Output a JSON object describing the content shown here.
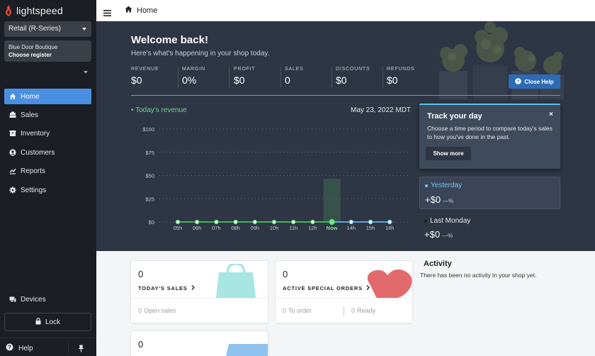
{
  "app": {
    "brand": "lightspeed"
  },
  "sidebar": {
    "store_select": "Retail (R-Series)",
    "register": {
      "shop": "Blue Door Boutique",
      "action": "Choose register"
    },
    "items": [
      {
        "label": "Home",
        "icon": "home-icon"
      },
      {
        "label": "Sales",
        "icon": "sales-icon"
      },
      {
        "label": "Inventory",
        "icon": "inventory-icon"
      },
      {
        "label": "Customers",
        "icon": "customers-icon"
      },
      {
        "label": "Reports",
        "icon": "reports-icon"
      },
      {
        "label": "Settings",
        "icon": "settings-icon"
      }
    ],
    "devices": "Devices",
    "lock": "Lock",
    "help": "Help"
  },
  "topbar": {
    "breadcrumb": "Home"
  },
  "hero": {
    "title": "Welcome back!",
    "subtitle": "Here's what's happening in your shop today.",
    "close_help": "Close Help",
    "kpis": [
      {
        "label": "REVENUE",
        "value": "$0"
      },
      {
        "label": "MARGIN",
        "value": "0%"
      },
      {
        "label": "PROFIT",
        "value": "$0"
      },
      {
        "label": "SALES",
        "value": "0"
      },
      {
        "label": "DISCOUNTS",
        "value": "$0"
      },
      {
        "label": "REFUNDS",
        "value": "$0"
      }
    ],
    "legend": "Today's revenue",
    "date": "May 23, 2022 MDT"
  },
  "chart_data": {
    "type": "line",
    "title": "",
    "x": [
      "05h",
      "06h",
      "07h",
      "08h",
      "09h",
      "10h",
      "11h",
      "12h",
      "Now",
      "14h",
      "15h",
      "16h"
    ],
    "yticks": [
      "$100",
      "$75",
      "$50",
      "$25",
      "$0"
    ],
    "ylim": [
      0,
      100
    ],
    "series": [
      {
        "name": "Today's revenue",
        "values": [
          0,
          0,
          0,
          0,
          0,
          0,
          0,
          0,
          0,
          null,
          null,
          null
        ],
        "color": "#4cd964"
      }
    ],
    "grid": true
  },
  "track": {
    "title": "Track your day",
    "body": "Choose a time period to compare today's sales to how you've done in the past.",
    "button": "Show more",
    "close": "×"
  },
  "comparisons": {
    "yesterday": {
      "label": "Yesterday",
      "value": "+$0",
      "pct": "—%"
    },
    "last_monday": {
      "label": "Last Monday",
      "value": "+$0",
      "pct": "—%"
    }
  },
  "cards": {
    "todays_sales": {
      "count": "0",
      "title": "TODAY'S SALES",
      "foot_num": "0",
      "foot_label": "Open sales"
    },
    "special_orders": {
      "count": "0",
      "title": "ACTIVE SPECIAL ORDERS",
      "to_order_num": "0",
      "to_order_label": "To order",
      "ready_num": "0",
      "ready_label": "Ready"
    },
    "third": {
      "count": "0"
    }
  },
  "activity": {
    "title": "Activity",
    "text": "There has been no activity in your shop yet."
  }
}
